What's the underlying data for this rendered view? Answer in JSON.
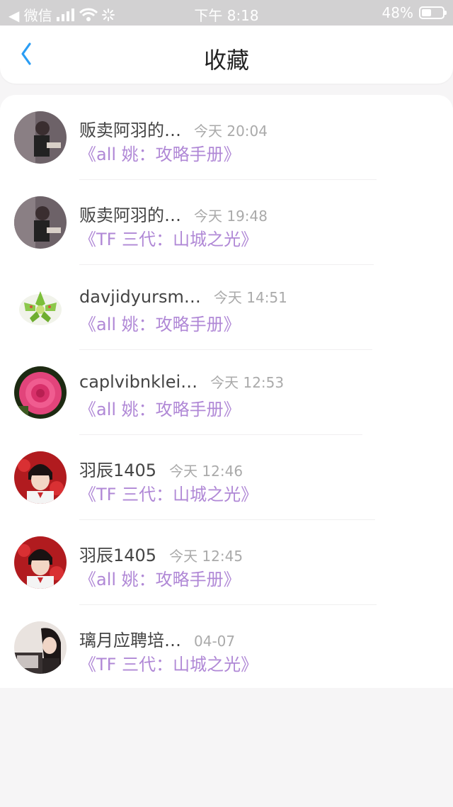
{
  "status_bar": {
    "carrier": "◀ 微信",
    "time": "下午 8:18",
    "battery": "48%",
    "battery_level": 0.48
  },
  "header": {
    "title": "收藏"
  },
  "items": [
    {
      "name": "贩卖阿羽的…",
      "time": "今天 20:04",
      "title": "《all 姚：攻略手册》"
    },
    {
      "name": "贩卖阿羽的…",
      "time": "今天 19:48",
      "title": "《TF 三代：山城之光》"
    },
    {
      "name": "davjidyursm…",
      "time": "今天 14:51",
      "title": "《all 姚：攻略手册》"
    },
    {
      "name": "caplvibnklei…",
      "time": "今天 12:53",
      "title": "《all 姚：攻略手册》"
    },
    {
      "name": "羽辰1405",
      "time": "今天 12:46",
      "title": "《TF 三代：山城之光》"
    },
    {
      "name": "羽辰1405",
      "time": "今天 12:45",
      "title": "《all 姚：攻略手册》"
    },
    {
      "name": "璃月应聘培…",
      "time": "04-07",
      "title": "《TF 三代：山城之光》"
    }
  ],
  "colors": {
    "accent": "#2a9df4",
    "title_purple": "#b088d6"
  }
}
